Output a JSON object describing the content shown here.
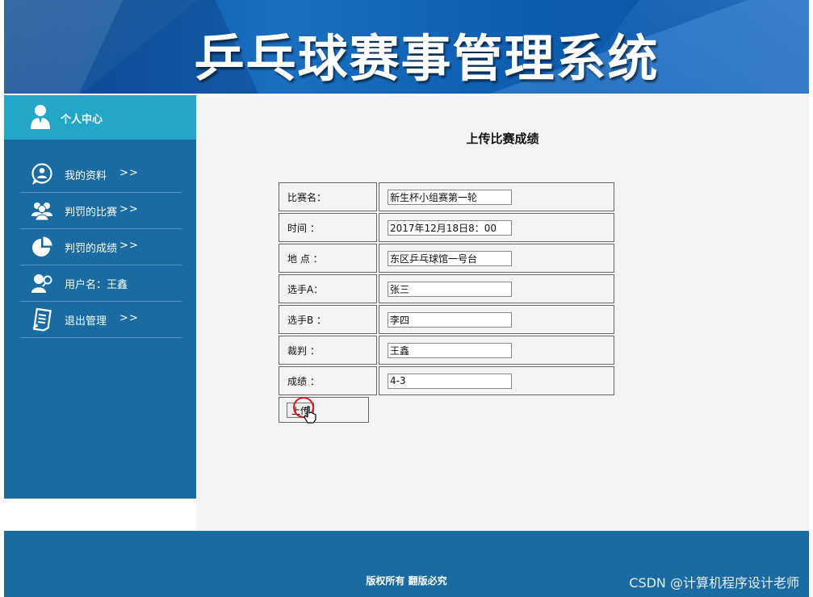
{
  "header": {
    "title": "乒乓球赛事管理系统"
  },
  "sidebar": {
    "personal_center": "个人中心",
    "items": [
      {
        "label": "我的资料",
        "arrow": ">>",
        "icon": "chat-bubble-icon"
      },
      {
        "label": "判罚的比赛",
        "arrow": ">>",
        "icon": "users-icon"
      },
      {
        "label": "判罚的成绩",
        "arrow": ">>",
        "icon": "pie-chart-icon"
      },
      {
        "label": "用户名：王鑫",
        "arrow": "",
        "icon": "user-key-icon"
      },
      {
        "label": "退出管理",
        "arrow": ">>",
        "icon": "document-icon"
      }
    ]
  },
  "form": {
    "title": "上传比赛成绩",
    "fields": [
      {
        "label": "比赛名：",
        "value": "新生杯小组赛第一轮"
      },
      {
        "label": "时间 ：",
        "value": "2017年12月18日8：00"
      },
      {
        "label": "地  点 ：",
        "value": "东区乒乓球馆一号台"
      },
      {
        "label": "选手A：",
        "value": "张三"
      },
      {
        "label": "选手B ：",
        "value": "李四"
      },
      {
        "label": "裁判 ：",
        "value": "王鑫"
      },
      {
        "label": "成绩 ：",
        "value": "4-3"
      }
    ],
    "submit_label": "上传"
  },
  "footer": {
    "copyright": "版权所有 翻版必究",
    "watermark": "CSDN @计算机程序设计老师"
  }
}
